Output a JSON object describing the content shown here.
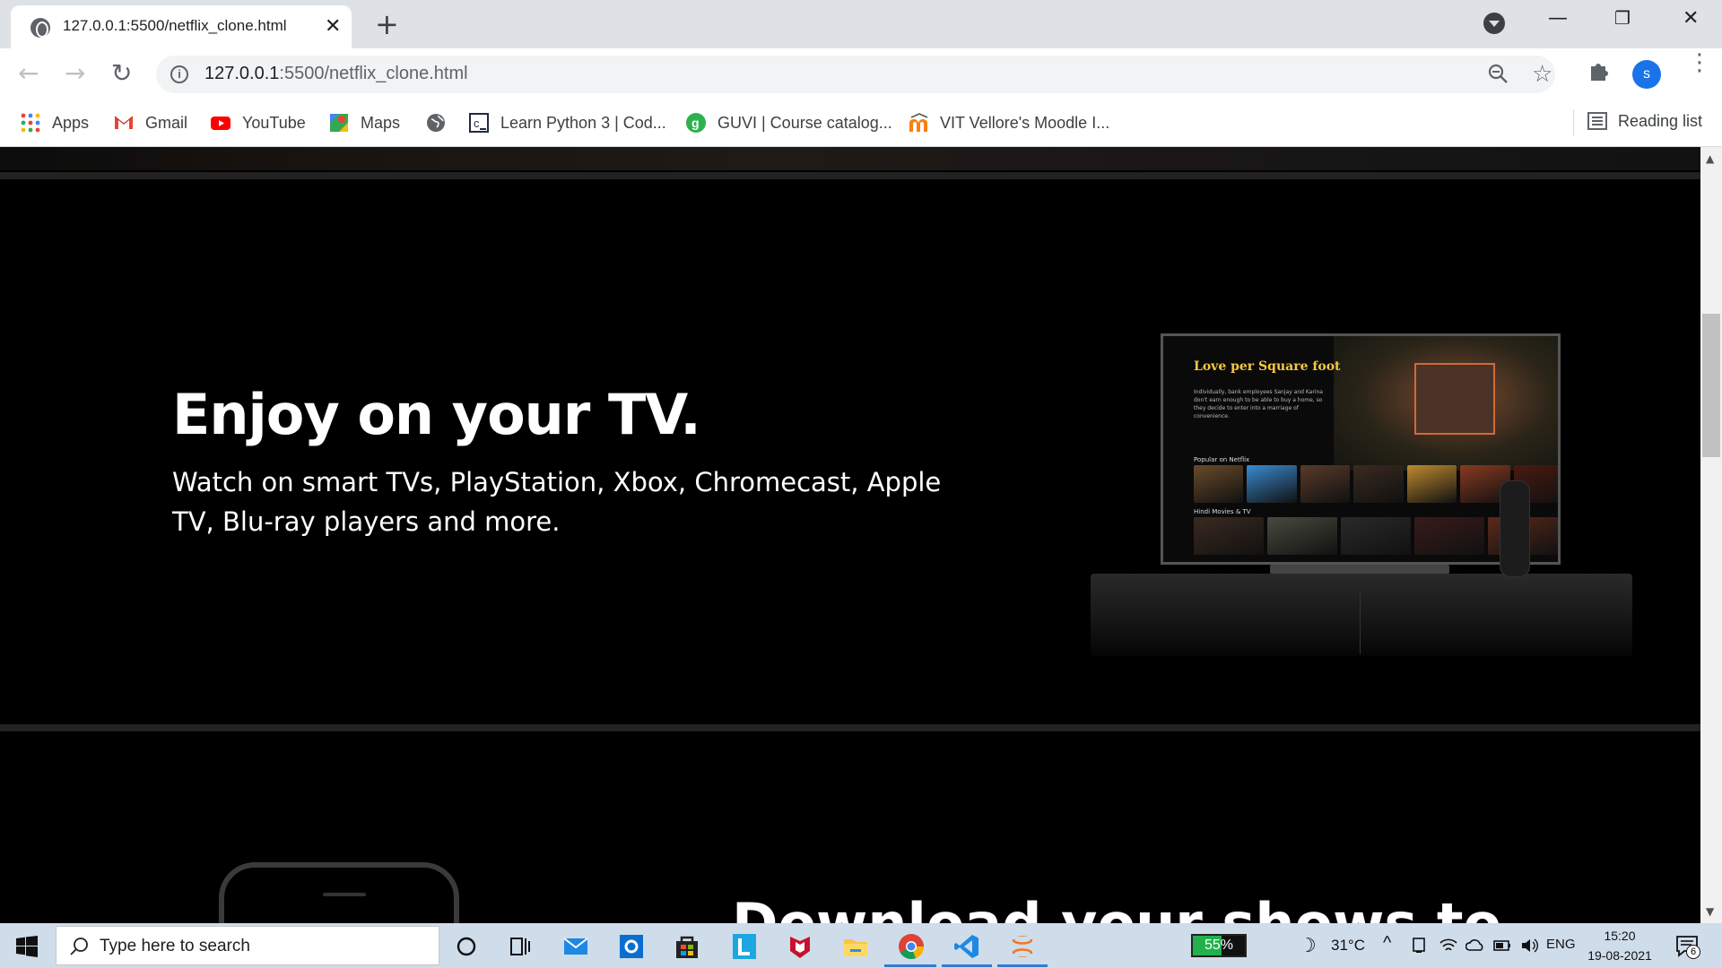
{
  "browser": {
    "tab_title": "127.0.0.1:5500/netflix_clone.html",
    "url_host": "127.0.0.1",
    "url_path": ":5500/netflix_clone.html",
    "new_tab_glyph": "+",
    "close_glyph": "✕"
  },
  "bookmarks": [
    {
      "label": "Apps",
      "icon": "apps-grid-icon"
    },
    {
      "label": "Gmail",
      "icon": "gmail-icon"
    },
    {
      "label": "YouTube",
      "icon": "youtube-icon"
    },
    {
      "label": "Maps",
      "icon": "maps-icon"
    },
    {
      "label": "",
      "icon": "globe-icon"
    },
    {
      "label": "Learn Python 3 | Cod...",
      "icon": "codecademy-icon"
    },
    {
      "label": "GUVI | Course catalog...",
      "icon": "guvi-icon"
    },
    {
      "label": "VIT Vellore's Moodle I...",
      "icon": "moodle-icon"
    }
  ],
  "reading_list": "Reading list",
  "avatar_letter": "s",
  "page": {
    "tv_heading": "Enjoy on your TV.",
    "tv_sub": "Watch on smart TVs, PlayStation, Xbox, Chromecast, Apple TV, Blu-ray players and more.",
    "download_heading": "Download your shows to",
    "screen": {
      "film_title": "Love per Square foot",
      "film_desc": "Individually, bank employees Sanjay and Karina don't earn enough to be able to buy a home, so they decide to enter into a marriage of convenience.",
      "row1_label": "Popular on Netflix",
      "row2_label": "Hindi Movies & TV",
      "row1_tiles": [
        "#6a4a2a",
        "#3a8ad0",
        "#5a3a2a",
        "#3a2a20",
        "#c08a30",
        "#8a3a20",
        "#4a1a10"
      ],
      "row2_tiles": [
        "#3a2a20",
        "#4a4a40",
        "#2a2a2a",
        "#3a1a1a",
        "#5a2a1a"
      ]
    }
  },
  "taskbar": {
    "search_placeholder": "Type here to search",
    "battery": "55%",
    "temperature": "31°C",
    "language": "ENG",
    "time": "15:20",
    "date": "19-08-2021",
    "notifications": "6"
  }
}
